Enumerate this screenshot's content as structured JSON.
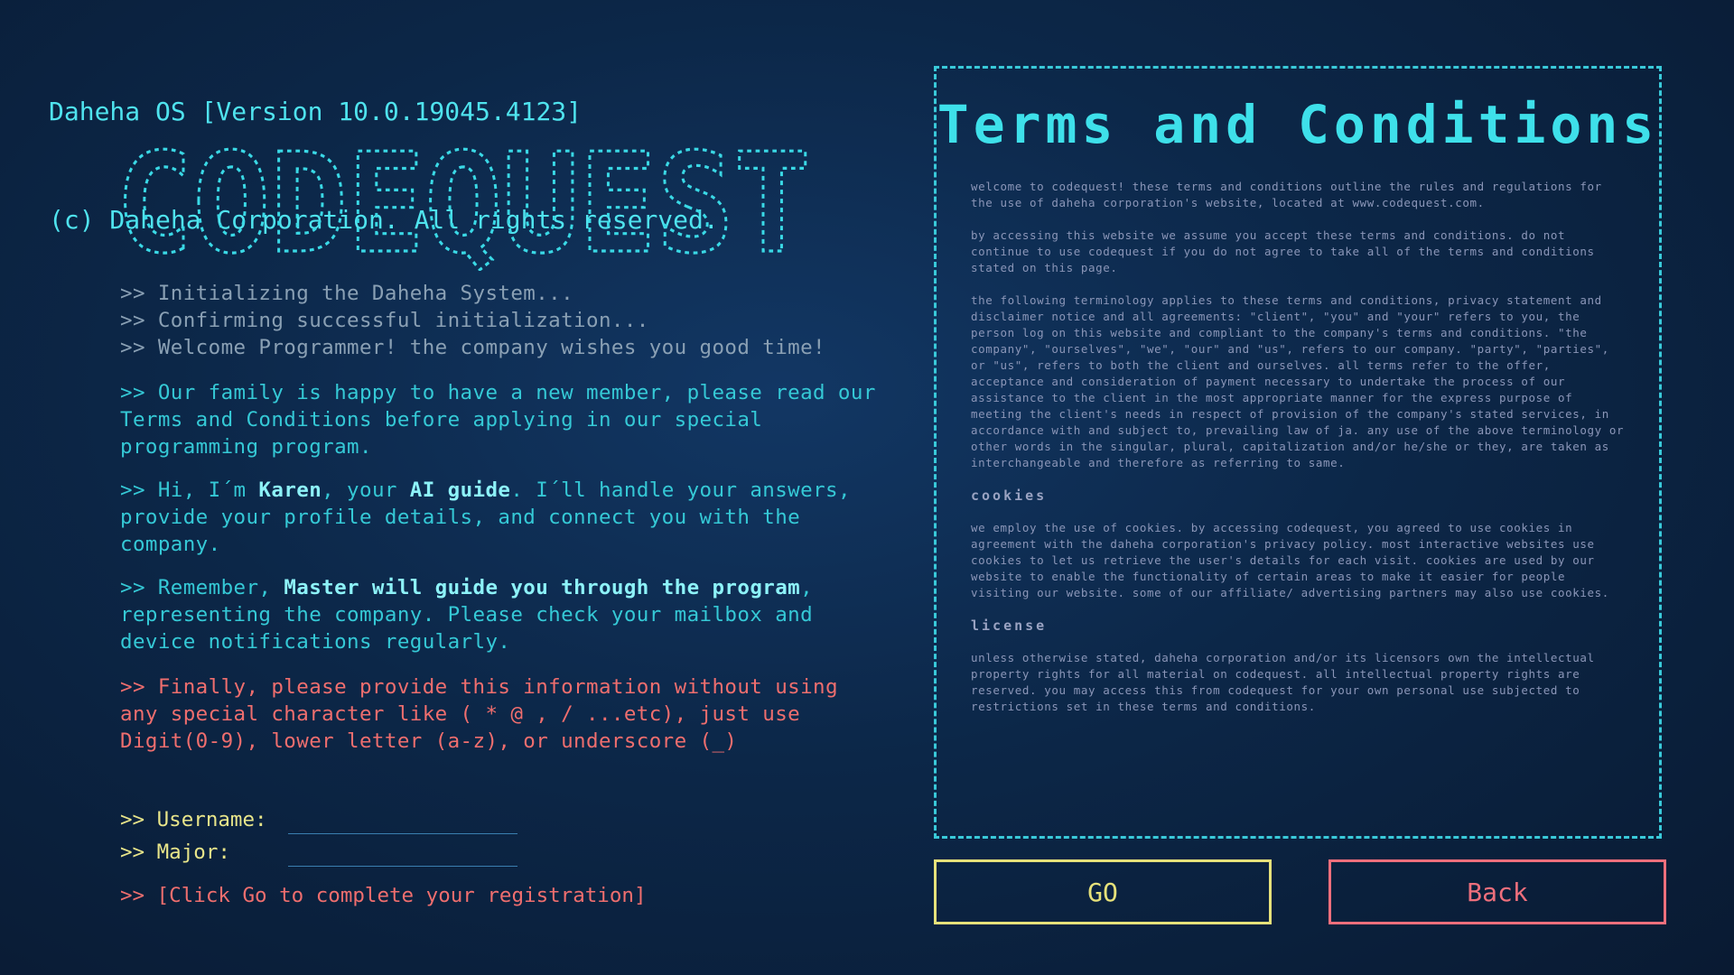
{
  "header": {
    "line1": "Daheha OS [Version 10.0.19045.4123]",
    "line2": "(c) Daheha Corporation. All rights reserved."
  },
  "logo": {
    "text": "CODEQUEST"
  },
  "intro": {
    "line1": ">> Initializing the Daheha System...",
    "line2": ">> Confirming successful initialization...",
    "line3": ">> Welcome Programmer! the company wishes you good time!"
  },
  "family": ">> Our family is happy to have a new member, please read our Terms and Conditions before applying in our special programming program.",
  "karen": {
    "p1": ">> Hi, I´m ",
    "name": "Karen",
    "p2": ", your ",
    "role": "AI guide",
    "p3": ". I´ll handle your answers, provide your profile details, and connect you with the company."
  },
  "remember": {
    "p1": ">> Remember, ",
    "master": "Master will guide you through the program",
    "p2": ", representing the company. Please check your mailbox and device notifications regularly."
  },
  "finally": ">> Finally, please provide this information without using any special character like ( * @ , / ...etc), just use Digit(0-9), lower letter (a-z), or underscore (_)",
  "form": {
    "username_label": ">> Username:",
    "username_value": "",
    "major_label": ">> Major:",
    "major_value": "",
    "hint": ">> [Click Go to complete your registration]"
  },
  "terms": {
    "title": "Terms and Conditions",
    "p1": "welcome to codequest! these terms and conditions outline the rules and regulations for the use of daheha corporation's website, located at www.codequest.com.",
    "p2": "by accessing this website we assume you accept these terms and conditions. do not continue to use codequest if you do not agree to take all of the terms and conditions stated on this page.",
    "p3": "the following terminology applies to these terms and conditions, privacy statement and disclaimer notice and all agreements: \"client\", \"you\" and \"your\" refers to you, the person log on this website and compliant to the company's terms and conditions. \"the company\", \"ourselves\", \"we\", \"our\" and \"us\", refers to our company. \"party\", \"parties\", or \"us\", refers to both the client and ourselves. all terms refer to the offer, acceptance and consideration of payment necessary to undertake the process of our assistance to the client in the most appropriate manner for the express purpose of meeting the client's needs in respect of provision of the company's stated services, in accordance with and subject to, prevailing law of ja. any use of the above terminology or other words in the singular, plural, capitalization and/or he/she or they, are taken as interchangeable and therefore as referring to same.",
    "h_cookies": "cookies",
    "p4": "we employ the use of cookies. by accessing codequest, you agreed to use cookies in agreement with the daheha corporation's privacy policy. most interactive websites use cookies to let us retrieve the user's details for each visit. cookies are used by our website to enable the functionality of certain areas to make it easier for people visiting our website. some of our affiliate/ advertising partners may also use cookies.",
    "h_license": "license",
    "p5": "unless otherwise stated, daheha corporation and/or its licensors own the intellectual property rights for all material on codequest. all intellectual property rights are reserved. you may access this from codequest for your own personal use subjected to restrictions set in these terms and conditions."
  },
  "buttons": {
    "go": "GO",
    "back": "Back"
  }
}
